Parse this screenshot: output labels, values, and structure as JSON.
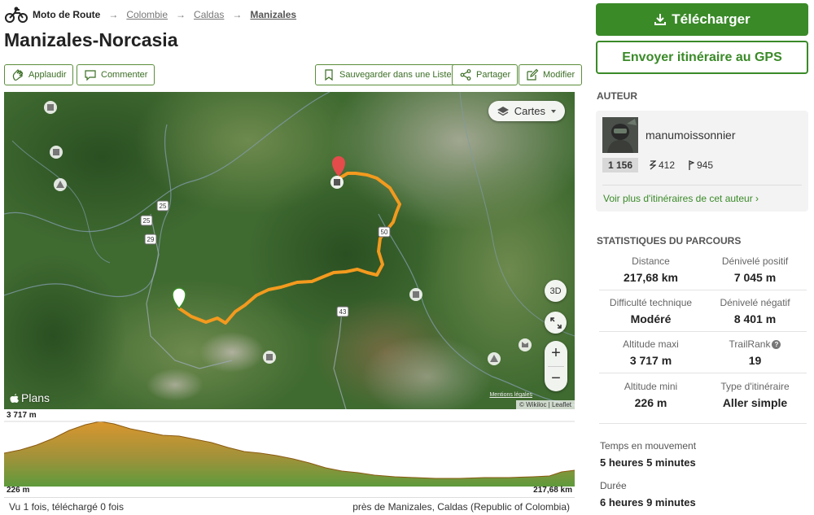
{
  "breadcrumb": {
    "home": "Moto de Route",
    "separator": "→",
    "items": [
      "Colombie",
      "Caldas",
      "Manizales"
    ]
  },
  "title": "Manizales-Norcasia",
  "actions": {
    "applaud": "Applaudir",
    "comment": "Commenter",
    "save_list": "Sauvegarder dans une Liste",
    "share": "Partager",
    "edit": "Modifier"
  },
  "map": {
    "layer_button": "Cartes",
    "btn_3d": "3D",
    "zoom_in": "+",
    "zoom_out": "−",
    "brand": "Plans",
    "legal": "Mentions légales",
    "attribution": "© Wikiloc | Leaflet",
    "road_labels": [
      "25",
      "25",
      "29",
      "43",
      "50"
    ]
  },
  "elevation": {
    "max_label": "3 717 m",
    "min_label": "226 m",
    "distance_label": "217,68 km",
    "fill_color": "#c98a2b"
  },
  "footer": {
    "views": "Vu 1 fois, téléchargé 0 fois",
    "near": "près de Manizales, Caldas (Republic of Colombia)"
  },
  "sidebar": {
    "download": "Télécharger",
    "send_gps": "Envoyer itinéraire au GPS",
    "author_title": "AUTEUR",
    "author": {
      "name": "manumoissonnier",
      "badge": "1 156",
      "followers": "412",
      "trails": "945",
      "more_link": "Voir plus d'itinéraires de cet auteur ›"
    },
    "stats_title": "STATISTIQUES DU PARCOURS",
    "stats": [
      {
        "label": "Distance",
        "value": "217,68 km"
      },
      {
        "label": "Dénivelé positif",
        "value": "7 045 m"
      },
      {
        "label": "Difficulté technique",
        "value": "Modéré"
      },
      {
        "label": "Dénivelé négatif",
        "value": "8 401 m"
      },
      {
        "label": "Altitude maxi",
        "value": "3 717 m"
      },
      {
        "label": "TrailRank",
        "value": "19"
      },
      {
        "label": "Altitude mini",
        "value": "226 m"
      },
      {
        "label": "Type d'itinéraire",
        "value": "Aller simple"
      }
    ],
    "moving_time_label": "Temps en mouvement",
    "moving_time_value": "5 heures 5 minutes",
    "duration_label": "Durée",
    "duration_value": "6 heures 9 minutes"
  },
  "colors": {
    "brand_green": "#3a8a28",
    "route_orange": "#f39a1e"
  }
}
